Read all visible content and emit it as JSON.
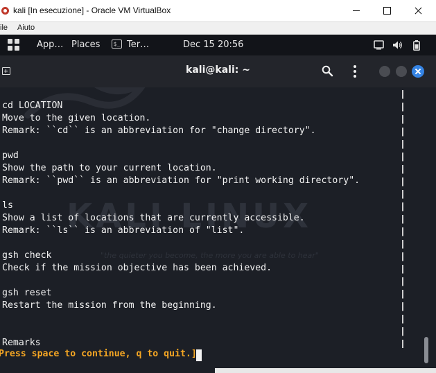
{
  "window": {
    "title": "kali [In esecuzione] - Oracle VM VirtualBox",
    "minimize_icon": "minimize-icon",
    "maximize_icon": "maximize-icon",
    "close_icon": "close-icon"
  },
  "vbox_menu": {
    "items": [
      "ile",
      "Aiuto"
    ]
  },
  "kali_panel": {
    "apps_label": "App…",
    "places_label": "Places",
    "terminal_label": "Ter…",
    "terminal_glyph": "$_",
    "datetime": "Dec 15  20:56"
  },
  "terminal": {
    "title": "kali@kali: ~",
    "watermark": "KALI LINUX",
    "watermark_quote": "\"the quieter you become, the more you are able to hear\"",
    "content": "cd LOCATION\nMove to the given location.\nRemark: ``cd`` is an abbreviation for \"change directory\".\n\npwd\nShow the path to your current location.\nRemark: ``pwd`` is an abbreviation for \"print working directory\".\n\nls\nShow a list of locations that are currently accessible.\nRemark: ``ls`` is an abbreviation of \"list\".\n\ngsh check\nCheck if the mission objective has been achieved.\n\ngsh reset\nRestart the mission from the beginning.\n\n\nRemarks",
    "pager_prompt": "Press space to continue, q to quit.]"
  },
  "colors": {
    "prompt": "#f5a623",
    "terminal_bg": "#1c1f26",
    "accent_close": "#3584e4"
  }
}
